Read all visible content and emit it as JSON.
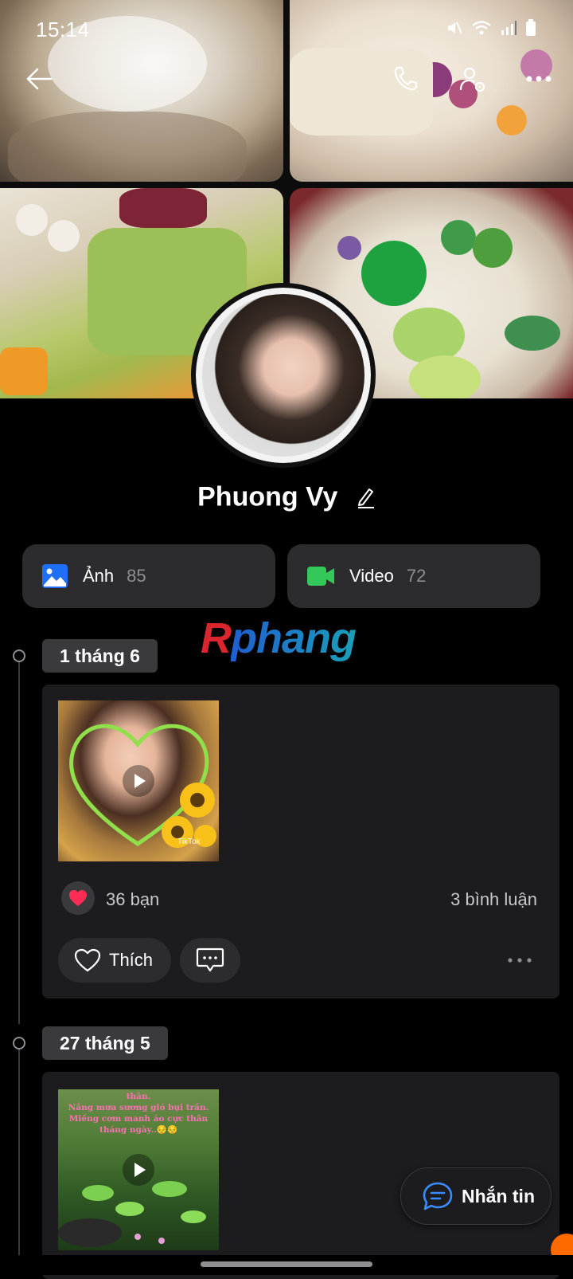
{
  "status_bar": {
    "time": "15:14"
  },
  "profile": {
    "name": "Phuong Vy"
  },
  "media": {
    "photos": {
      "label": "Ảnh",
      "count": "85"
    },
    "videos": {
      "label": "Video",
      "count": "72"
    }
  },
  "watermark": "Rphang",
  "timeline": [
    {
      "date": "1 tháng 6",
      "reactions": "36 bạn",
      "comments": "3 bình luận",
      "like_label": "Thích",
      "thumb_watermark": "TikTok"
    },
    {
      "date": "27 tháng 5",
      "thumb_caption": "thân.\nNắng mưa sương gió bụi trần.\nMiếng cơm manh áo cực thân\ntháng ngày..😔😔"
    }
  ],
  "chat_button": {
    "label": "Nhắn tin"
  },
  "colors": {
    "accent_blue": "#1e6ff5",
    "video_green": "#34c759",
    "heart_red": "#ff2d55"
  }
}
